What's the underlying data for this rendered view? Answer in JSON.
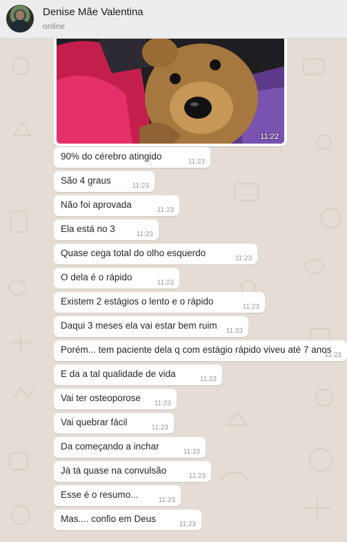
{
  "header": {
    "contact_name": "Denise Mãe Valentina",
    "status": "online"
  },
  "image_message": {
    "time": "11:22"
  },
  "messages": [
    {
      "text": "90% do cérebro atingido",
      "time": "11:23"
    },
    {
      "text": "São 4 graus",
      "time": "11:23"
    },
    {
      "text": "Não foi aprovada",
      "time": "11:23"
    },
    {
      "text": "Ela está no 3",
      "time": "11:23"
    },
    {
      "text": "Quase cega total do olho esquerdo",
      "time": "11:23"
    },
    {
      "text": "O dela é o rápido",
      "time": "11:23"
    },
    {
      "text": "Existem 2 estágios o lento e o rápido",
      "time": "11:23"
    },
    {
      "text": "Daqui 3 meses ela vai estar bem ruim",
      "time": "11:23"
    },
    {
      "text": "Porém... tem paciente dela q com estágio rápido viveu até 7 anos",
      "time": "11:23"
    },
    {
      "text": "E da a tal qualidade de vida",
      "time": "11:23"
    },
    {
      "text": "Vai ter osteoporose",
      "time": "11:23"
    },
    {
      "text": "Vai quebrar fácil",
      "time": "11:23"
    },
    {
      "text": "Da começando a inchar",
      "time": "11:23"
    },
    {
      "text": "Já tá quase na convulsão",
      "time": "11:23"
    },
    {
      "text": "Esse é o resumo...",
      "time": "11:23"
    },
    {
      "text": "Mas.... confio em Deus",
      "time": "11:23"
    }
  ],
  "colors": {
    "header_bg": "#ededed",
    "chat_bg": "#e5ddd5",
    "bubble_bg": "#ffffff",
    "timestamp": "#9a9a9a"
  }
}
